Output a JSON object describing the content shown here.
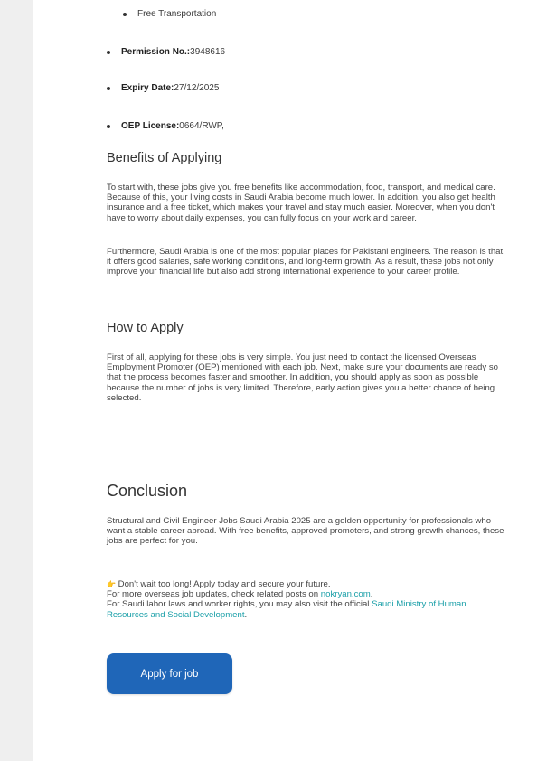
{
  "bullets": {
    "free_transportation": "Free Transportation",
    "permission_label": "Permission No.:",
    "permission_value": " 3948616",
    "expiry_label": "Expiry Date:",
    "expiry_value": " 27/12/2025",
    "oep_label": "OEP License:",
    "oep_value": " 0664/RWP,"
  },
  "benefits": {
    "heading": "Benefits of Applying",
    "para1": "To start with, these jobs give you free benefits like accommodation, food, transport, and medical care. Because of this, your living costs in Saudi Arabia become much lower. In addition, you also get health insurance and a free ticket, which makes your travel and stay much easier. Moreover, when you don't have to worry about daily expenses, you can fully focus on your work and career.",
    "para2": "Furthermore, Saudi Arabia is one of the most popular places for Pakistani engineers. The reason is that it offers good salaries, safe working conditions, and long-term growth. As a result, these jobs not only improve your financial life but also add strong international experience to your career profile."
  },
  "how_to_apply": {
    "heading": "How to Apply",
    "para": "First of all, applying for these jobs is very simple. You just need to contact the licensed Overseas Employment Promoter (OEP) mentioned with each job. Next, make sure your documents are ready so that the process becomes faster and smoother. In addition, you should apply as soon as possible because the number of jobs is very limited. Therefore, early action gives you a better chance of being selected."
  },
  "conclusion": {
    "heading": "Conclusion",
    "para": "Structural and Civil Engineer Jobs Saudi Arabia 2025 are a golden opportunity for professionals who want a stable career abroad. With free benefits, approved promoters, and strong growth chances, these jobs are perfect for you."
  },
  "note": {
    "icon": "pointing-hand-icon",
    "icon_glyph": "👉",
    "line1": " Don't wait too long! Apply today and secure your future.",
    "line2_prefix": "For more overseas job updates, check related posts on ",
    "line2_link": "nokryan.com",
    "line2_suffix": ".",
    "line3_prefix": "For Saudi labor laws and worker rights, you may also visit the official ",
    "line3_link": "Saudi Ministry of Human Resources and Social Development",
    "line3_suffix": "."
  },
  "button": {
    "apply_label": "Apply for job",
    "color": "#1f66b8"
  },
  "colors": {
    "link": "#1a9fa8",
    "background": "#efefef",
    "page": "#ffffff"
  }
}
